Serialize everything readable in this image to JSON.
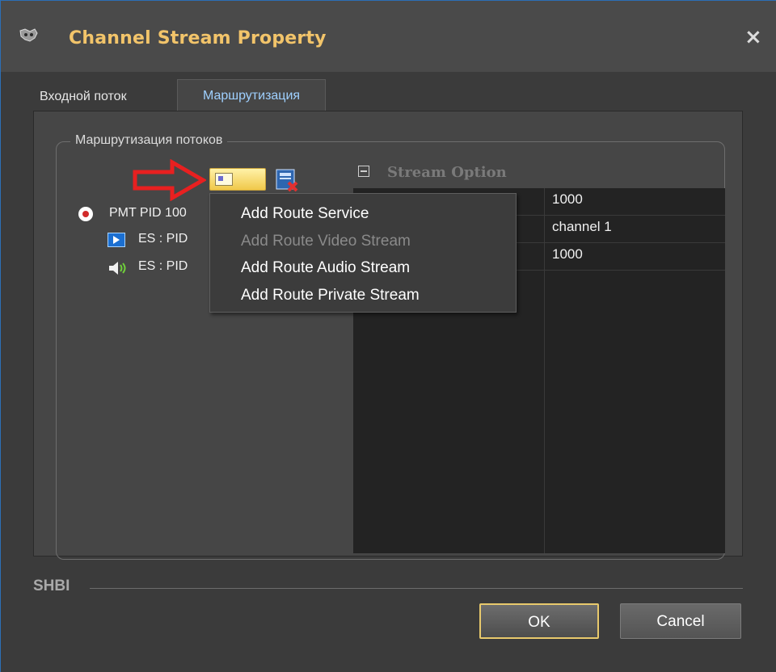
{
  "window": {
    "title": "Channel Stream Property",
    "close_glyph": "×"
  },
  "tabs": [
    {
      "label": "Входной поток",
      "active": false
    },
    {
      "label": "Маршрутизация",
      "active": true
    }
  ],
  "group": {
    "label": "Маршрутизация потоков"
  },
  "toolbar": {
    "add_icon": "add-route-icon",
    "delete_icon": "delete-route-icon",
    "pointer_icon": "red-arrow-icon"
  },
  "tree": {
    "pmt": "PMT PID 100",
    "video_es": "ES : PID",
    "audio_es": "ES : PID"
  },
  "stream_option": {
    "title": "Stream Option",
    "values": [
      "1000",
      "channel 1",
      "1000"
    ]
  },
  "context_menu": {
    "items": [
      {
        "label": "Add Route Service",
        "enabled": true
      },
      {
        "label": "Add Route Video Stream",
        "enabled": false
      },
      {
        "label": "Add Route Audio Stream",
        "enabled": true
      },
      {
        "label": "Add Route Private Stream",
        "enabled": true
      }
    ]
  },
  "footer": {
    "brand": "SHBI",
    "ok_label": "OK",
    "cancel_label": "Cancel"
  },
  "colors": {
    "title_text": "#f2c46a",
    "active_tab_text": "#9fd0ff",
    "ok_border": "#e8c96c"
  }
}
